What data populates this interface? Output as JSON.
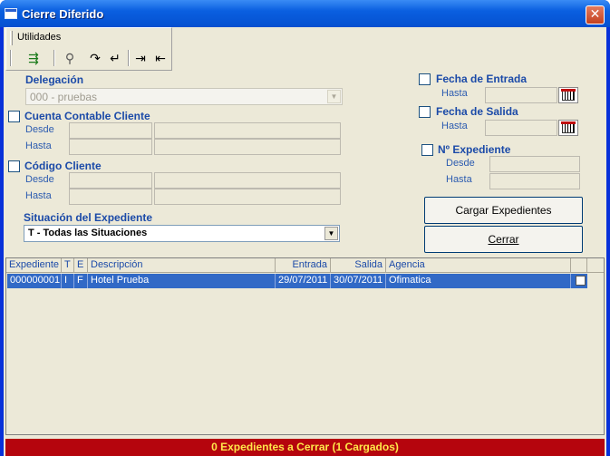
{
  "window": {
    "title": "Cierre Diferido",
    "close_glyph": "✕"
  },
  "menu": {
    "utilidades": "Utilidades"
  },
  "toolbar": {
    "icons": [
      "exit-icon",
      "find-icon",
      "redo-icon",
      "undo-icon",
      "first-icon",
      "last-icon"
    ]
  },
  "delegacion": {
    "label": "Delegación",
    "value": "000 - pruebas"
  },
  "cuenta": {
    "label": "Cuenta Contable Cliente",
    "desde": "Desde",
    "hasta": "Hasta"
  },
  "codigo": {
    "label": "Código Cliente",
    "desde": "Desde",
    "hasta": "Hasta"
  },
  "situacion": {
    "label": "Situación del Expediente",
    "value": "T - Todas las Situaciones"
  },
  "fecha_entrada": {
    "label": "Fecha de Entrada",
    "hasta": "Hasta"
  },
  "fecha_salida": {
    "label": "Fecha de Salida",
    "hasta": "Hasta"
  },
  "expediente": {
    "label": "Nº Expediente",
    "desde": "Desde",
    "hasta": "Hasta"
  },
  "buttons": {
    "cargar": "Cargar Expedientes",
    "cerrar": "Cerrar"
  },
  "grid": {
    "columns": [
      "Expediente",
      "T",
      "E",
      "Descripción",
      "Entrada",
      "Salida",
      "Agencia"
    ],
    "rows": [
      {
        "expediente": "000000001",
        "t": "I",
        "e": "F",
        "descripcion": "Hotel Prueba",
        "entrada": "29/07/2011",
        "salida": "30/07/2011",
        "agencia": "Ofimatica"
      }
    ]
  },
  "status": {
    "text": "0 Expedientes a Cerrar (1 Cargados)"
  },
  "colors": {
    "status_bg": "#b5050d",
    "status_text": "#ffe74a",
    "selection": "#3169c6",
    "label_blue": "#1b4aa8"
  }
}
